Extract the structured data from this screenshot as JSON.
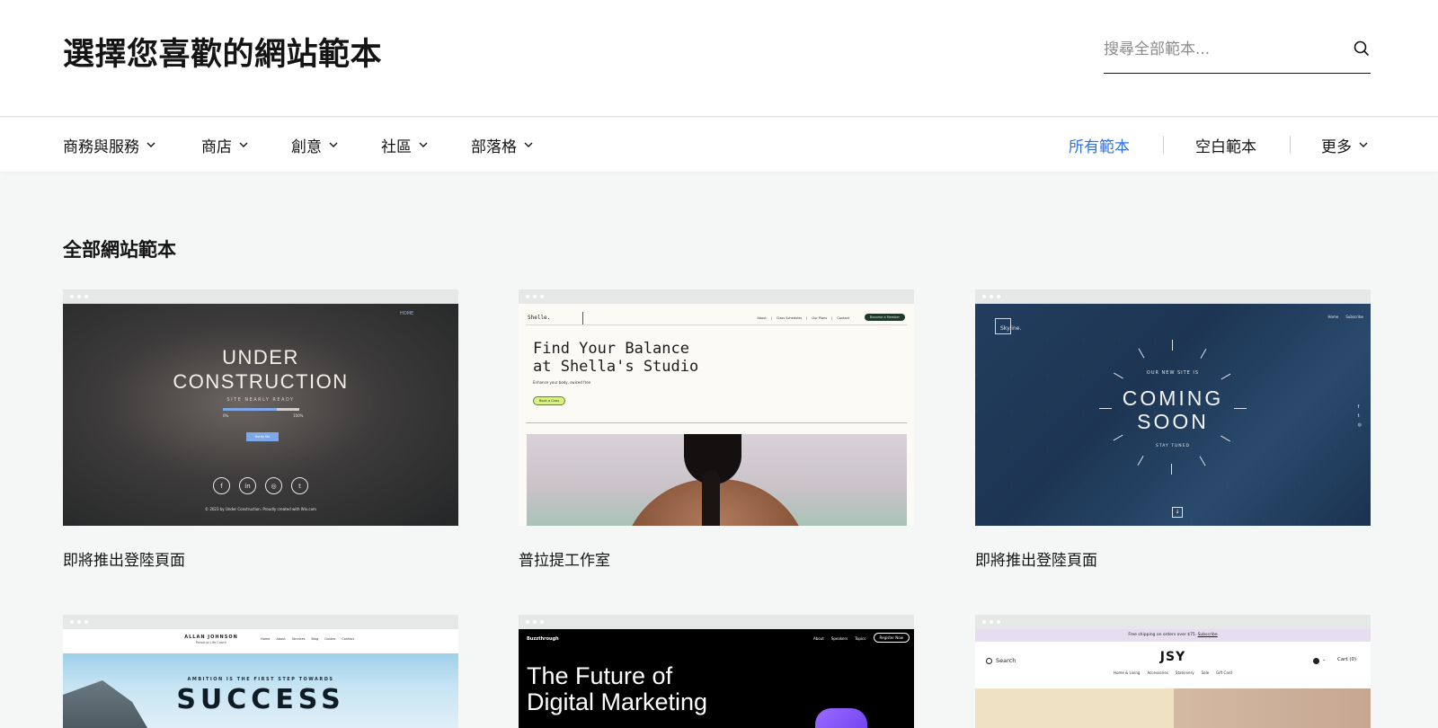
{
  "header": {
    "title": "選擇您喜歡的網站範本",
    "search_placeholder": "搜尋全部範本..."
  },
  "nav": {
    "categories": [
      {
        "label": "商務與服務"
      },
      {
        "label": "商店"
      },
      {
        "label": "創意"
      },
      {
        "label": "社區"
      },
      {
        "label": "部落格"
      }
    ],
    "right": {
      "all": "所有範本",
      "blank": "空白範本",
      "more": "更多"
    },
    "active_color": "#2f73e0"
  },
  "section_title": "全部網站範本",
  "cards": [
    {
      "title": "即將推出登陸頁面",
      "preview": {
        "nav_link": "HOME",
        "heading_line1": "UNDER",
        "heading_line2": "CONSTRUCTION",
        "subtitle": "SITE NEARLY READY",
        "progress_start": "0%",
        "progress_end": "100%",
        "progress": 0.7,
        "button": "Notify Me",
        "social_icons": [
          "facebook-icon",
          "linkedin-icon",
          "instagram-icon",
          "twitter-icon"
        ],
        "social_glyphs": [
          "f",
          "in",
          "◎",
          "t"
        ],
        "footer": "© 2023 by Under Construction. Proudly created with Wix.com"
      }
    },
    {
      "title": "普拉提工作室",
      "preview": {
        "brand": "Shelle.",
        "links": [
          "About",
          "Class Schedules",
          "Our Plans",
          "Contact"
        ],
        "cta": "Become a Member",
        "heading_line1": "Find Your Balance",
        "heading_line2": "at Shella's Studio",
        "subtitle": "Enhance your body, swiced free",
        "button": "Book a Class"
      }
    },
    {
      "title": "即將推出登陸頁面",
      "preview": {
        "brand": "Skyline.",
        "links": [
          "Home",
          "Subscribe"
        ],
        "eyebrow": "OUR NEW SITE IS",
        "heading_line1": "COMING",
        "heading_line2": "SOON",
        "subtitle": "STAY TUNED",
        "side_icons": [
          "f",
          "t",
          "◎"
        ],
        "scroll_icon": "↓"
      }
    }
  ],
  "bottom_cards": [
    {
      "preview": {
        "name": "ALLAN JOHNSON",
        "role": "Personal Life Coach",
        "links": [
          "Home",
          "About",
          "Services",
          "Blog",
          "Guides",
          "Contact"
        ],
        "eyebrow": "AMBITION IS THE FIRST STEP TOWARDS",
        "heading": "SUCCESS"
      }
    },
    {
      "preview": {
        "brand": "Buzzthrough",
        "links": [
          "About",
          "Speakers",
          "Topics"
        ],
        "cta": "Register Now",
        "heading_line1": "The Future of",
        "heading_line2": "Digital Marketing"
      }
    },
    {
      "preview": {
        "promo": "Free shipping on orders over $75.",
        "promo_link": "Subscribe",
        "search": "Search",
        "brand": "JSY",
        "categories": [
          "Home & Living",
          "Accessories",
          "Stationery",
          "Sale",
          "Gift Card"
        ],
        "cart": "Cart (0)"
      }
    }
  ]
}
